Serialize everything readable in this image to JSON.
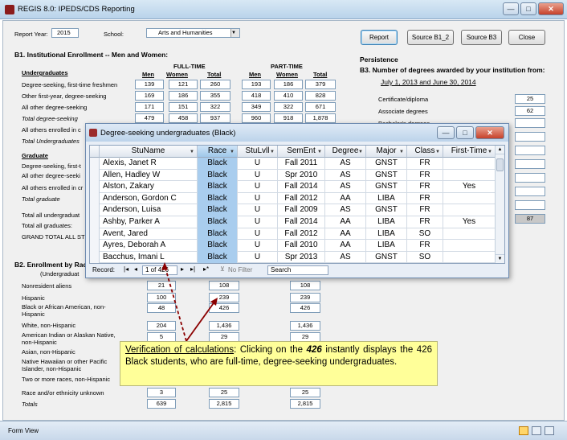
{
  "window": {
    "title": "REGIS 8.0: IPEDS/CDS Reporting",
    "minimize": "—",
    "maximize": "□",
    "close": "✕"
  },
  "header": {
    "report_year_label": "Report Year:",
    "report_year": "2015",
    "school_label": "School:",
    "school_value": "Arts and Humanities",
    "buttons": {
      "report": "Report",
      "source_b12": "Source B1_2",
      "source_b3": "Source B3",
      "close": "Close"
    }
  },
  "b1": {
    "title": "B1.  Institutional Enrollment -- Men and Women:",
    "fulltime": "FULL-TIME",
    "parttime": "PART-TIME",
    "col_men": "Men",
    "col_women": "Women",
    "col_total": "Total",
    "undergrad_heading": "Undergraduates",
    "rows": [
      {
        "label": "Degree-seeking, first-time freshmen",
        "v": [
          "139",
          "121",
          "260",
          "193",
          "186",
          "379"
        ]
      },
      {
        "label": "Other first-year, degree-seeking",
        "v": [
          "169",
          "186",
          "355",
          "418",
          "410",
          "828"
        ]
      },
      {
        "label": "All other degree-seeking",
        "v": [
          "171",
          "151",
          "322",
          "349",
          "322",
          "671"
        ]
      },
      {
        "label": "Total degree-seeking",
        "v": [
          "479",
          "458",
          "937",
          "960",
          "918",
          "1,878"
        ]
      },
      {
        "label": "All others enrolled in c",
        "v": []
      },
      {
        "label": "Total Undergraduates",
        "v": []
      }
    ],
    "graduate_heading": "Graduate",
    "grad_rows": [
      "Degree-seeking, first-t",
      "All other degree-seeki",
      "All others enrolled in cr",
      "Total graduate"
    ],
    "totals": [
      "Total all undergraduat",
      "Total all graduates:",
      "GRAND TOTAL ALL STU"
    ]
  },
  "b2": {
    "title": "B2.  Enrollment by Rac",
    "subtitle": "(Undergraduat",
    "rows": [
      {
        "label": "Nonresident aliens",
        "v": [
          "21",
          "108",
          "108"
        ]
      },
      {
        "label": "Hispanic",
        "v": [
          "100",
          "239",
          "239"
        ]
      },
      {
        "label": "Black or African American, non-Hispanic",
        "v": [
          "48",
          "426",
          "426"
        ]
      },
      {
        "label": "White, non-Hispanic",
        "v": [
          "204",
          "1,436",
          "1,436"
        ]
      },
      {
        "label": "American Indian or Alaskan Native, non-Hispanic",
        "v": [
          "5",
          "29",
          "29"
        ]
      },
      {
        "label": "Asian, non-Hispanic",
        "v": [
          "",
          "",
          ""
        ]
      },
      {
        "label": "Native Hawaiian or other Pacific Islander, non-Hispanic",
        "v": [
          "",
          "",
          ""
        ]
      },
      {
        "label": "Two or more races, non-Hispanic",
        "v": [
          "",
          "",
          ""
        ]
      },
      {
        "label": "Race and/or ethnicity unknown",
        "v": [
          "3",
          "25",
          "25"
        ]
      },
      {
        "label": "Totals",
        "v": [
          "639",
          "2,815",
          "2,815"
        ]
      }
    ]
  },
  "b3": {
    "persistence": "Persistence",
    "title": "B3.  Number of degrees awarded by your institution from:",
    "date_range": "July 1, 2013 and June 30, 2014",
    "rows": [
      {
        "label": "Certificate/diploma",
        "v": "25"
      },
      {
        "label": "Associate degrees",
        "v": "62"
      },
      {
        "label": "Bachelor's degrees",
        "v": ""
      }
    ],
    "gray_value": "87"
  },
  "popup": {
    "title": "Degree-seeking undergraduates (Black)",
    "columns": [
      "StuName",
      "Race",
      "StuLvll",
      "SemEnt",
      "Degree",
      "Major",
      "Class",
      "First-Time"
    ],
    "rows": [
      [
        "Alexis, Janet R",
        "Black",
        "U",
        "Fall 2011",
        "AS",
        "GNST",
        "FR",
        ""
      ],
      [
        "Allen, Hadley W",
        "Black",
        "U",
        "Spr 2010",
        "AS",
        "GNST",
        "FR",
        ""
      ],
      [
        "Alston, Zakary",
        "Black",
        "U",
        "Fall 2014",
        "AS",
        "GNST",
        "FR",
        "Yes"
      ],
      [
        "Anderson, Gordon C",
        "Black",
        "U",
        "Fall 2012",
        "AA",
        "LIBA",
        "FR",
        ""
      ],
      [
        "Anderson, Luisa",
        "Black",
        "U",
        "Fall 2009",
        "AS",
        "GNST",
        "FR",
        ""
      ],
      [
        "Ashby, Parker A",
        "Black",
        "U",
        "Fall 2014",
        "AA",
        "LIBA",
        "FR",
        "Yes"
      ],
      [
        "Avent, Jared",
        "Black",
        "U",
        "Fall 2012",
        "AA",
        "LIBA",
        "SO",
        ""
      ],
      [
        "Ayres, Deborah A",
        "Black",
        "U",
        "Fall 2010",
        "AA",
        "LIBA",
        "FR",
        ""
      ],
      [
        "Bacchus, Imani L",
        "Black",
        "U",
        "Spr 2013",
        "AS",
        "GNST",
        "SO",
        ""
      ]
    ],
    "nav": {
      "record_label": "Record:",
      "position": "1 of 426",
      "filter": "No Filter",
      "search": "Search"
    }
  },
  "note": {
    "lead": "Verification of calculations",
    "text_a": ":  Clicking on the ",
    "number": "426",
    "text_b": " instantly displays the 426 Black students, who are full-time, degree-seeking undergraduates."
  },
  "status": {
    "left": "Form View"
  }
}
